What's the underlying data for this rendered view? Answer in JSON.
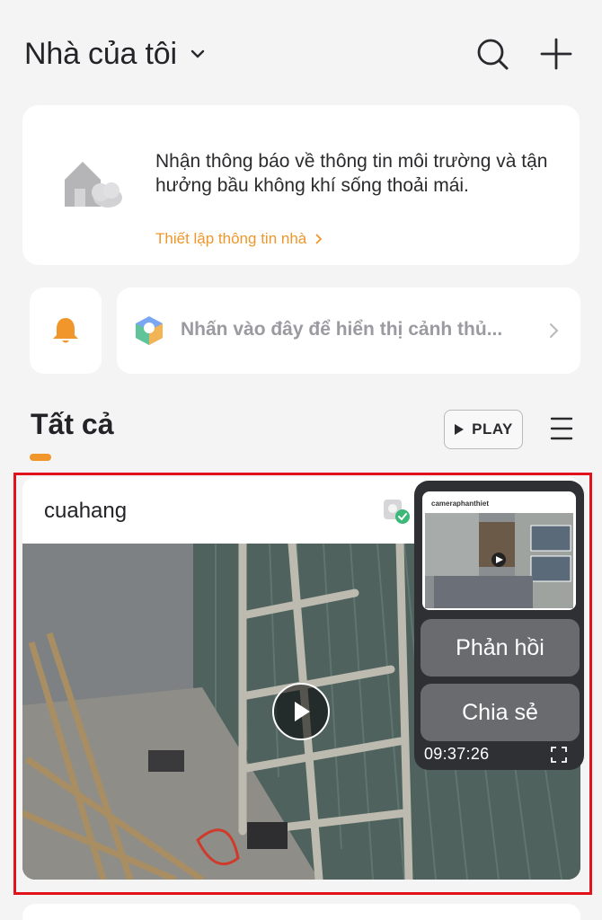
{
  "header": {
    "home_title": "Nhà của tôi",
    "icons": {
      "dropdown": "chevron-down-icon",
      "search": "search-icon",
      "add": "plus-icon"
    }
  },
  "info_card": {
    "message": "Nhận thông báo về thông tin môi trường và tận hưởng bầu không khí sống thoải mái.",
    "link": "Thiết lập thông tin nhà",
    "icon": "house-cloud-icon"
  },
  "scene_bar": {
    "bell_icon": "bell-icon",
    "scene_icon": "scene-cube-icon",
    "text": "Nhấn vào đây để hiển thị cảnh thủ..."
  },
  "section": {
    "tab_label": "Tất cả",
    "play_label": "PLAY",
    "menu_icon": "hamburger-menu-icon"
  },
  "camera_card": {
    "name": "cuahang",
    "status_icon": "camera-online-icon"
  },
  "floating_panel": {
    "preview_title": "cameraphanthiet",
    "feedback_label": "Phản hồi",
    "share_label": "Chia sẻ",
    "time": "09:37:26",
    "expand_icon": "fullscreen-icon"
  },
  "colors": {
    "accent": "#f0962b",
    "background": "#f4f4f5",
    "card": "#ffffff",
    "highlight": "#e3111a"
  }
}
